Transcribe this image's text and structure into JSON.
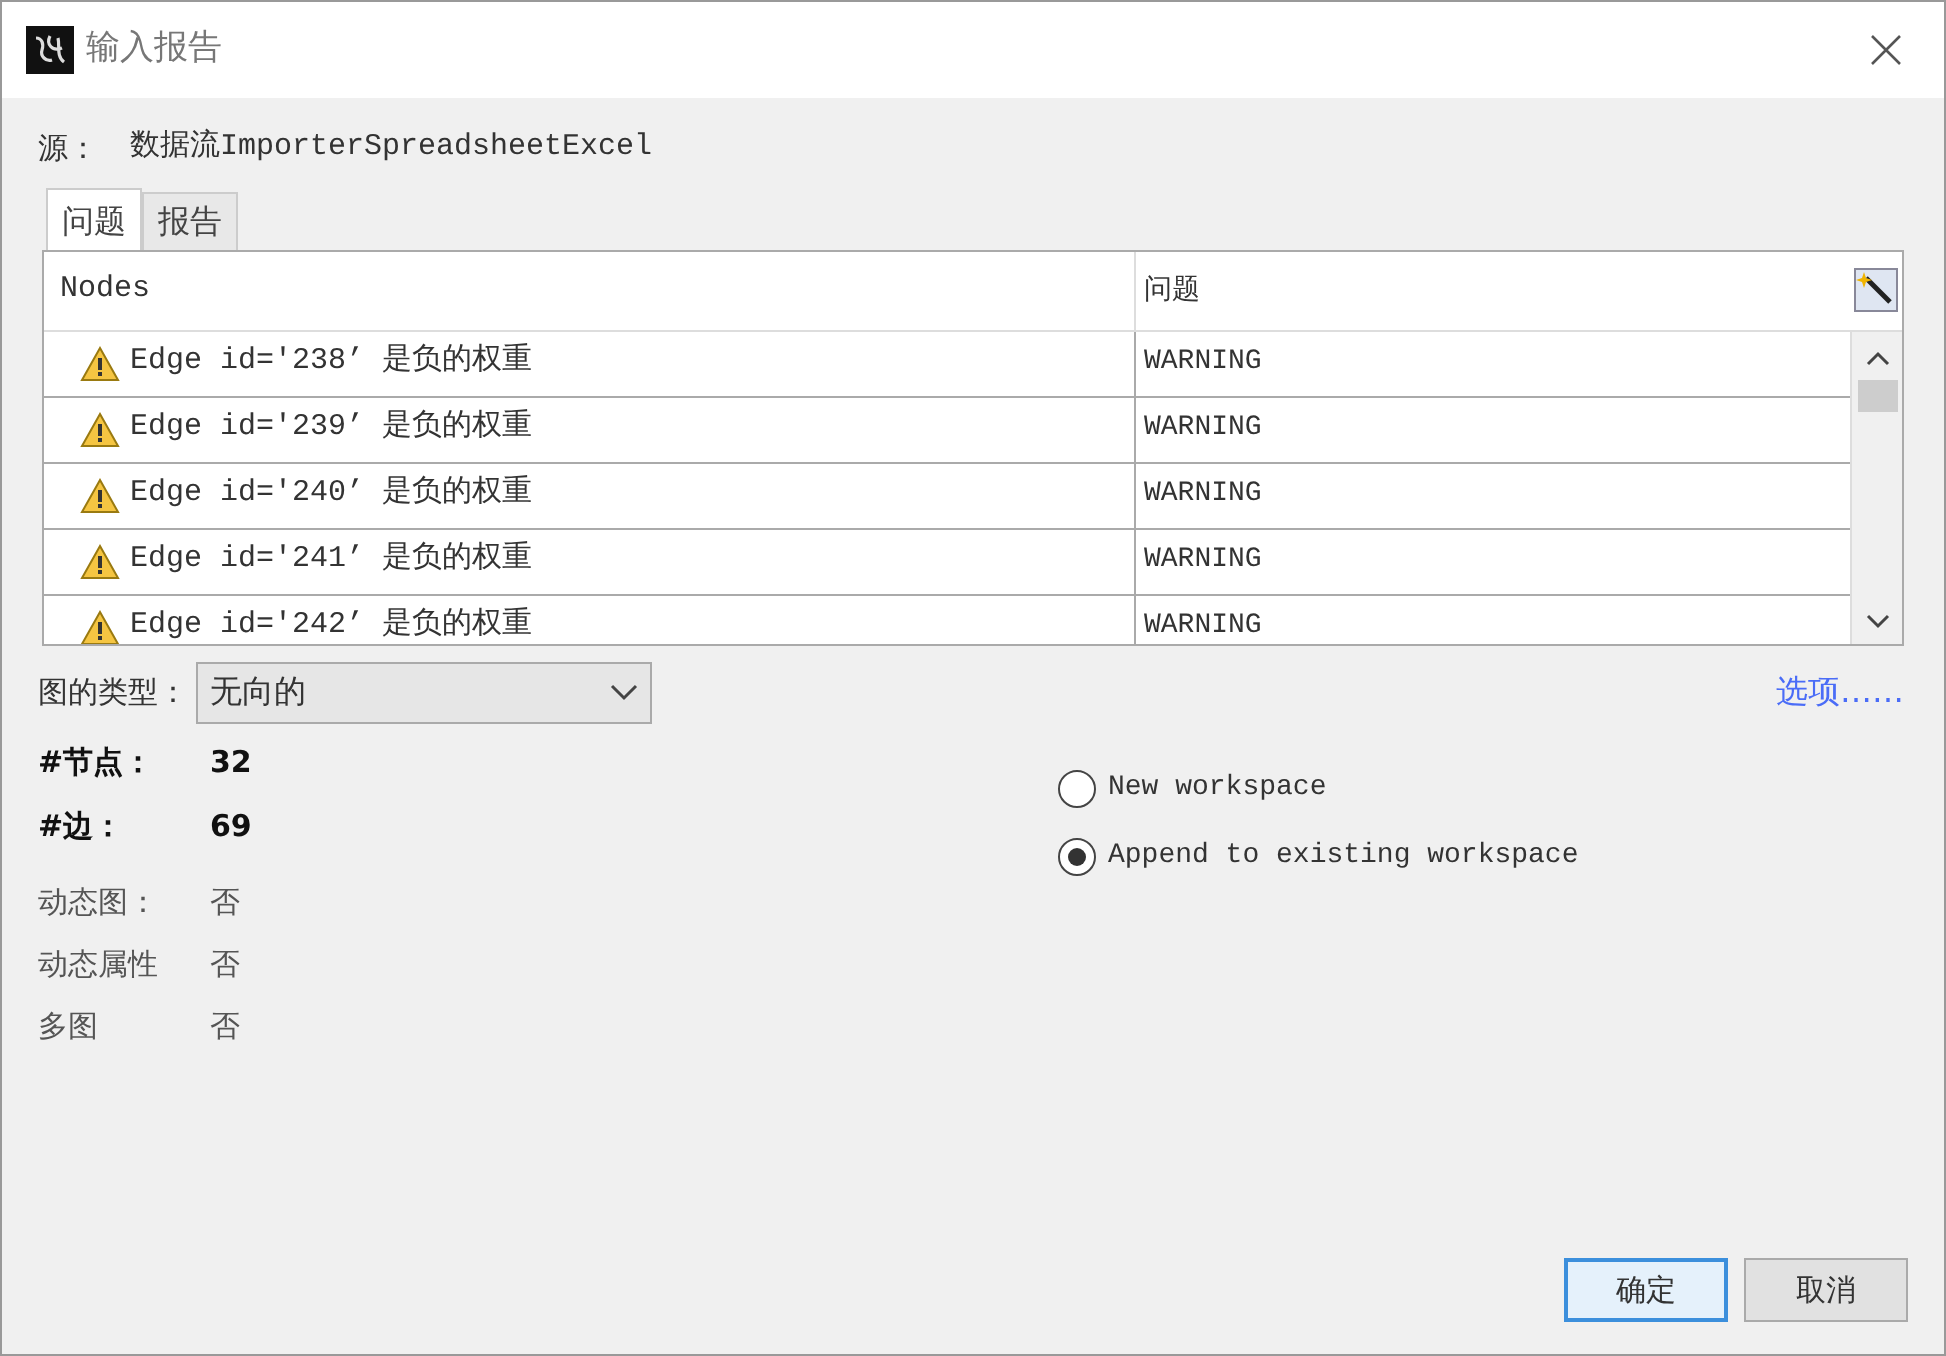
{
  "window": {
    "title": "输入报告"
  },
  "source": {
    "label": "源：",
    "value": "数据流ImporterSpreadsheetExcel"
  },
  "tabs": [
    {
      "label": "问题",
      "selected": true
    },
    {
      "label": "报告",
      "selected": false
    }
  ],
  "issues": {
    "columns": [
      "Nodes",
      "问题"
    ],
    "rows": [
      {
        "message": "Edge id='238’ 是负的权重",
        "severity": "WARNING"
      },
      {
        "message": "Edge id='239’ 是负的权重",
        "severity": "WARNING"
      },
      {
        "message": "Edge id='240’ 是负的权重",
        "severity": "WARNING"
      },
      {
        "message": "Edge id='241’ 是负的权重",
        "severity": "WARNING"
      },
      {
        "message": "Edge id='242’ 是负的权重",
        "severity": "WARNING"
      }
    ]
  },
  "graph_type": {
    "label": "图的类型：",
    "value": "无向的"
  },
  "options_link": "选项……",
  "stats": [
    {
      "label": "#节点：",
      "value": "32",
      "kind": "bold"
    },
    {
      "label": "#边：",
      "value": "69",
      "kind": "bold"
    },
    {
      "label": "动态图：",
      "value": "否",
      "kind": "plain"
    },
    {
      "label": "动态属性",
      "value": "否",
      "kind": "plain"
    },
    {
      "label": "多图",
      "value": "否",
      "kind": "plain"
    }
  ],
  "workspace_options": [
    {
      "label": "New workspace",
      "selected": false
    },
    {
      "label": "Append to existing workspace",
      "selected": true
    }
  ],
  "buttons": [
    {
      "label": "确定",
      "default": true
    },
    {
      "label": "取消",
      "default": false
    }
  ]
}
